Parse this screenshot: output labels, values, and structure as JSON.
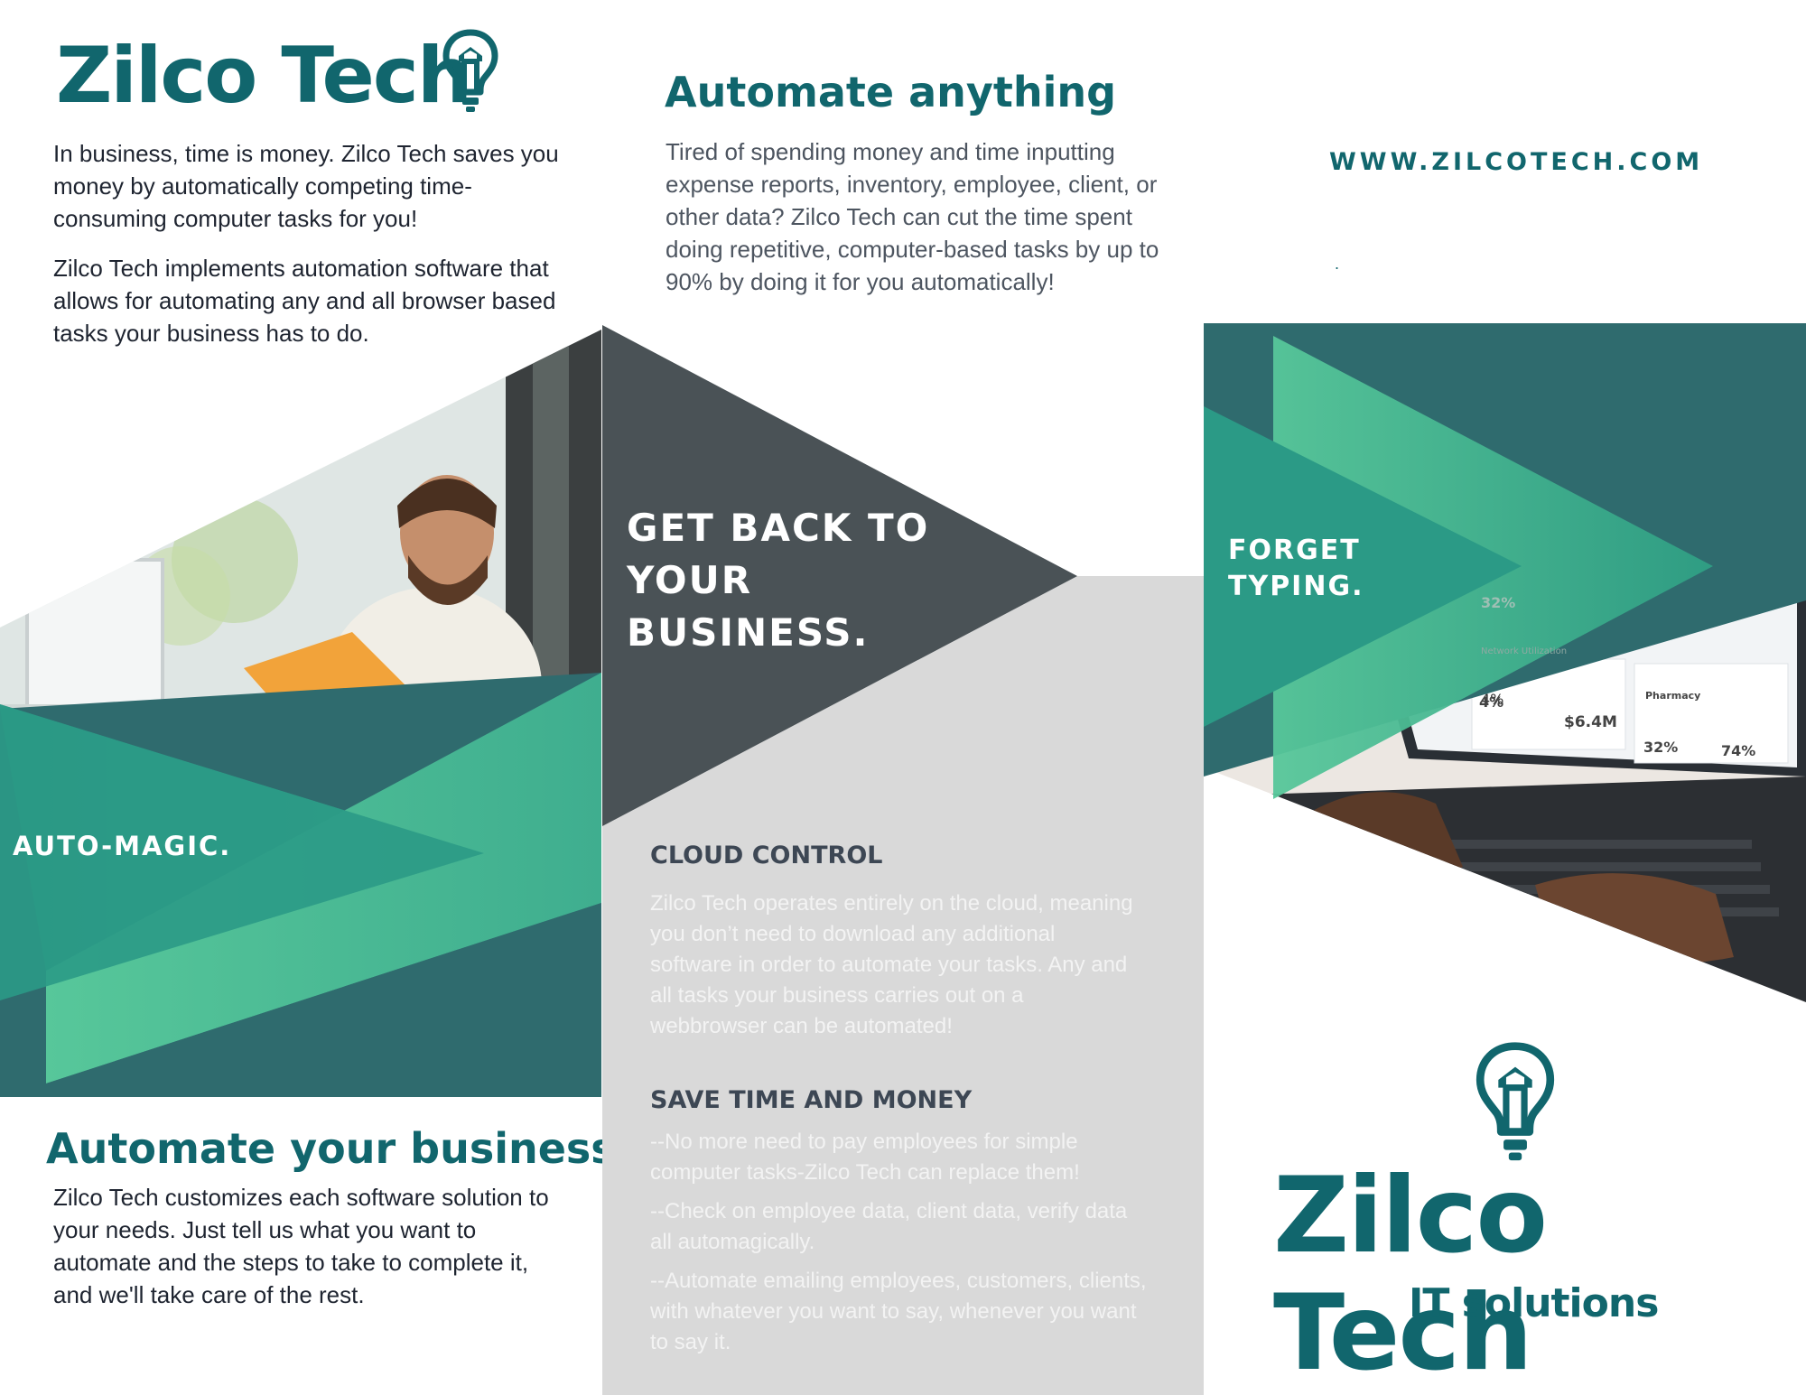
{
  "panel1": {
    "brand": "Zilco Tech",
    "intro_p1": "In business, time is money. Zilco Tech saves you money by automatically competing time-consuming computer tasks for you!",
    "intro_p2": "Zilco Tech implements automation software that allows for automating any and all browser based tasks your business has to do.",
    "banner": "AUTO-MAGIC.",
    "section_title": "Automate your business",
    "section_body": "Zilco Tech customizes each software solution to your needs. Just tell us what you want to automate and the steps to take to complete it, and we'll take care of the rest."
  },
  "panel2": {
    "title": "Automate anything",
    "body": "Tired of spending money and time inputting expense reports, inventory, employee, client, or other data? Zilco Tech can cut the time spent doing repetitive, computer-based tasks by up to 90% by doing it for you automatically!",
    "banner_line1": "GET BACK TO",
    "banner_line2": "YOUR",
    "banner_line3": "BUSINESS.",
    "cloud_title": "CLOUD CONTROL",
    "cloud_body": "Zilco Tech operates entirely on the cloud, meaning you don’t need to download any additional software in order to automate your tasks. Any and all tasks your business carries out on a webbrowser can be automated!",
    "save_title": "SAVE TIME AND MONEY",
    "save_items": [
      "--No more need to pay employees for simple computer tasks-Zilco Tech can replace them!",
      "--Check on employee data, client data, verify data all automagically.",
      "--Automate emailing employees, customers, clients, with whatever you want to say, whenever you want to say it."
    ]
  },
  "panel3": {
    "website": "WWW.ZILCOTECH.COM",
    "dot": ".",
    "banner_line1": "FORGET",
    "banner_line2": "TYPING.",
    "laptop_stats": [
      "32%",
      "4%",
      "$6.4M",
      "32%",
      "74%"
    ],
    "laptop_labels": [
      "Network Utilization",
      "Pharmacy"
    ],
    "brand": "Zilco Tech",
    "tagline": "IT solutions"
  },
  "colors": {
    "brand_teal": "#11666d",
    "dark_teal": "#2f6b6e",
    "mid_teal": "#2b9a86",
    "light_green": "#57c79a",
    "slate": "#4a5256",
    "gray_panel": "#d9d9d9"
  },
  "icons": [
    "lightbulb-icon"
  ]
}
